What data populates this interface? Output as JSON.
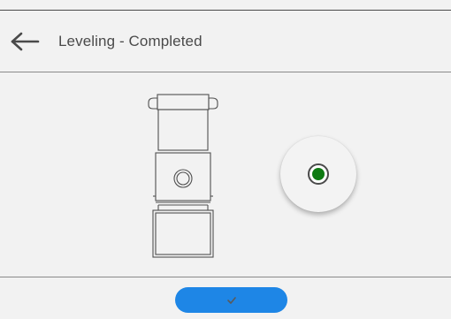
{
  "header": {
    "back_icon": "arrow-left-icon",
    "title": "Leveling - Completed"
  },
  "level_indicator": {
    "status": "level",
    "bubble_color": "#0e7a12"
  },
  "footer": {
    "confirm_icon": "checkmark-icon",
    "button_color": "#1e86e6"
  }
}
